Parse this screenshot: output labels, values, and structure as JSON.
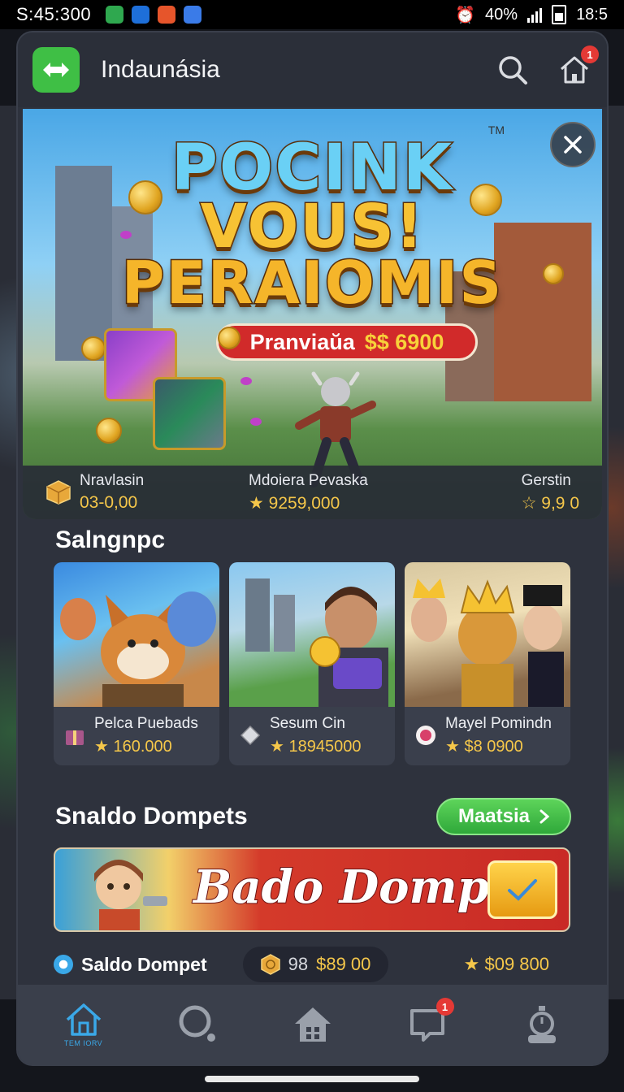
{
  "status_bar": {
    "time": "S:45:300",
    "battery_text": "40%",
    "clock_right": "18:5"
  },
  "header": {
    "title": "Indaunásia",
    "notification_count": "1"
  },
  "hero": {
    "title_line_1": "POCINK",
    "title_line_2": "VOUS!",
    "title_line_3": "PERAIOMIS",
    "trademark": "TM",
    "price_label": "Pranviaŭa",
    "price_value": "$$ 6900",
    "stats": [
      {
        "name": "Nravlasin",
        "value": "03-0,00"
      },
      {
        "name": "Mdoiera Pevaska",
        "value": "★ 9259,000"
      },
      {
        "name": "Gerstin",
        "value": "☆ 9,9 0"
      }
    ]
  },
  "section1": {
    "title": "Salngnpc",
    "tiles": [
      {
        "name": "Pelca Puebads",
        "value": "★ 160.000"
      },
      {
        "name": "Sesum Cin",
        "value": "★ 18945000"
      },
      {
        "name": "Mayel Pomindn",
        "value": "★ $8 0900"
      }
    ]
  },
  "section2": {
    "title": "Snaldo Dompets",
    "more_button": "Maatsia",
    "banner_text": "Bado Dompet",
    "balance_label": "Saldo Dompet",
    "coin_prefix": "98",
    "coin_value": "$89 00",
    "star_value": "★ $09 800"
  },
  "bottom_nav": {
    "home_caption": "TEM IORV",
    "notifications_count": "1"
  },
  "colors": {
    "accent_green": "#3fbf45",
    "gold": "#f5c74a",
    "badge_red": "#e53935",
    "card_bg": "#2e323d"
  }
}
